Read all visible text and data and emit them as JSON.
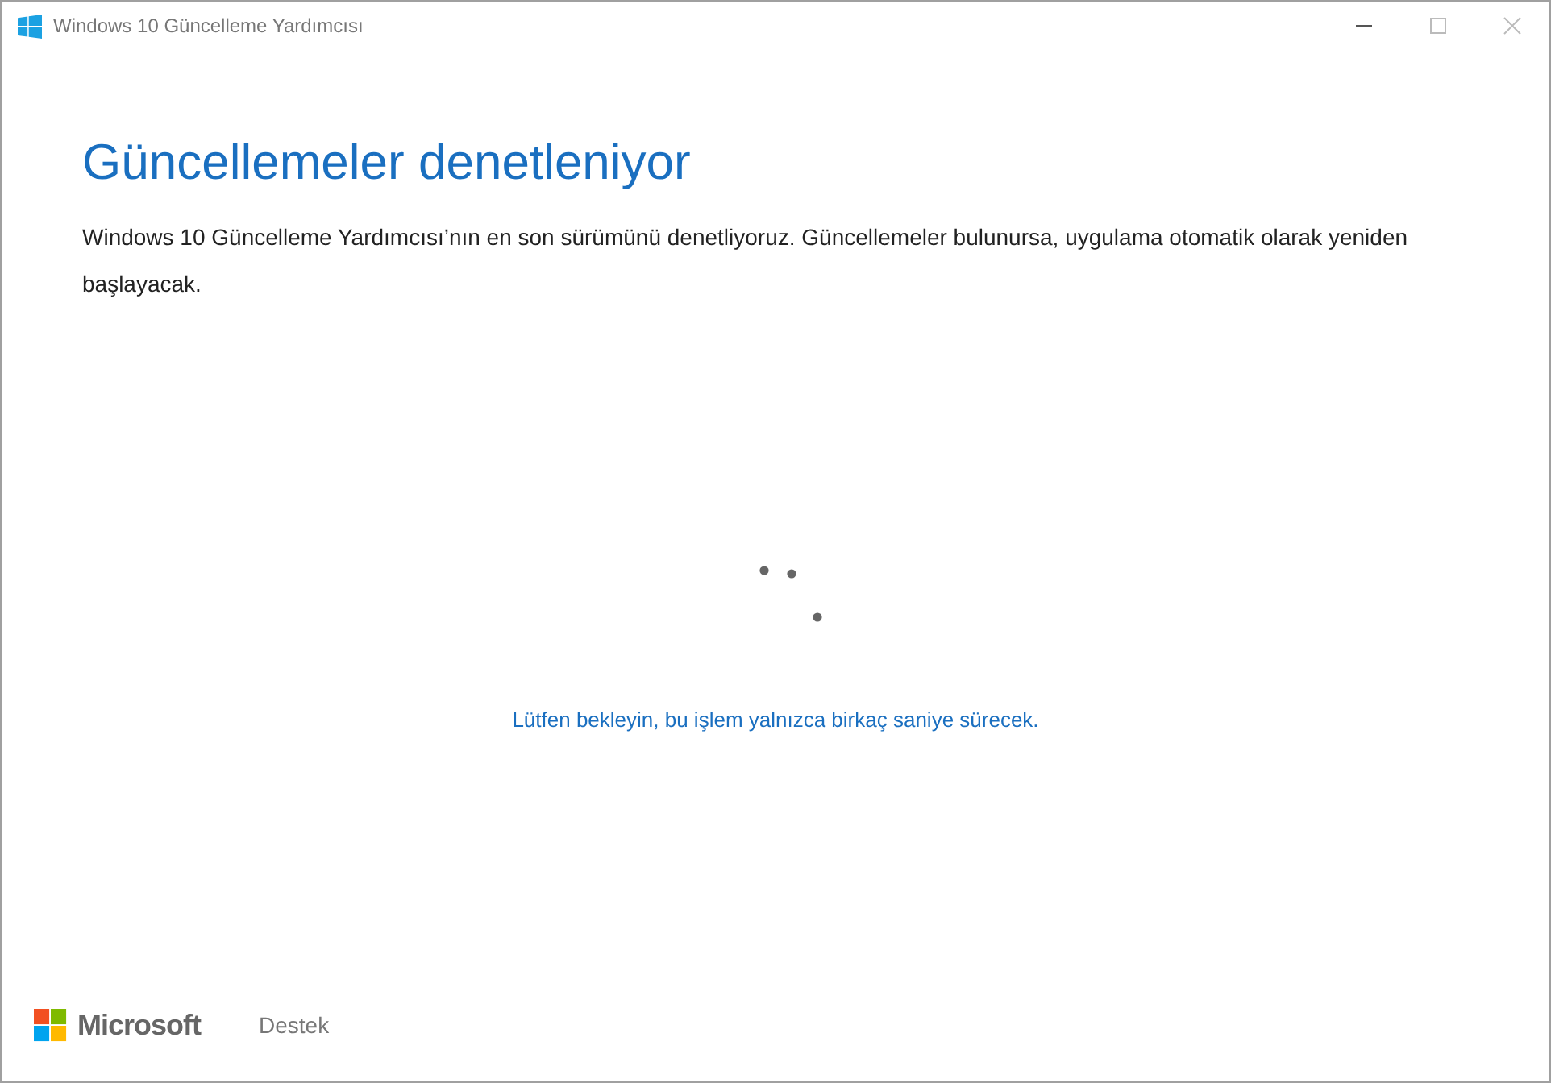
{
  "window": {
    "title": "Windows 10 Güncelleme Yardımcısı"
  },
  "heading": "Güncellemeler denetleniyor",
  "description": "Windows 10 Güncelleme Yardımcısı’nın en son sürümünü denetliyoruz. Güncellemeler bulunursa, uygulama otomatik olarak yeniden başlayacak.",
  "wait_message": "Lütfen bekleyin, bu işlem yalnızca birkaç saniye sürecek.",
  "footer": {
    "brand": "Microsoft",
    "link": "Destek"
  }
}
